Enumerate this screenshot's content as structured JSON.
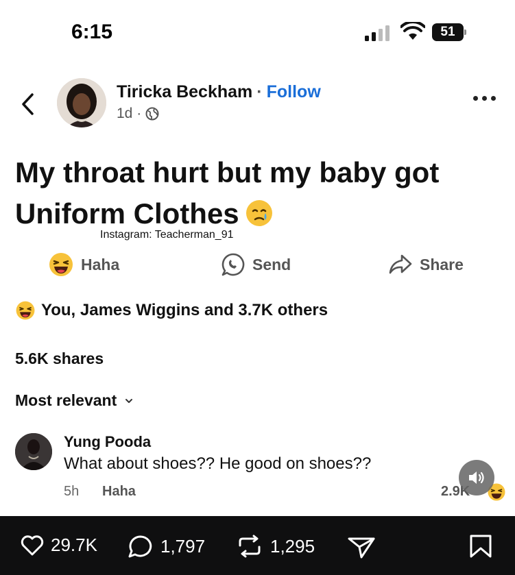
{
  "status_bar": {
    "time": "6:15",
    "battery": "51"
  },
  "post": {
    "author": "Tiricka Beckham",
    "separator": "·",
    "follow_label": "Follow",
    "age": "1d ·",
    "text": "My throat hurt but my baby got Uniform Clothes",
    "watermark": "Instagram: Teacherman_91"
  },
  "actions": {
    "haha_label": "Haha",
    "send_label": "Send",
    "share_label": "Share"
  },
  "engagement": {
    "reactions_summary": "You, James Wiggins and 3.7K others",
    "shares": "5.6K shares",
    "sort_label": "Most relevant"
  },
  "comment": {
    "author": "Yung Pooda",
    "text": "What about shoes?? He good on shoes??",
    "time": "5h",
    "react_label": "Haha",
    "react_count": "2.9K"
  },
  "bottom_bar": {
    "likes": "29.7K",
    "comments": "1,797",
    "reposts": "1,295"
  },
  "colors": {
    "accent": "#1a6ed8",
    "bottom_bar_bg": "#0f0f10"
  }
}
